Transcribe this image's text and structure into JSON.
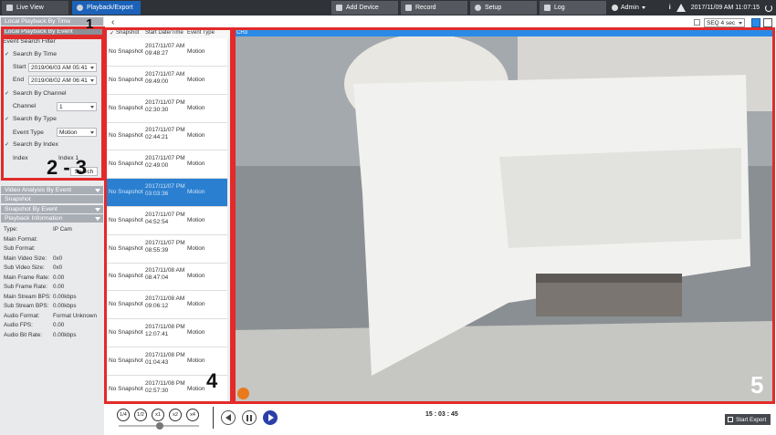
{
  "topbar": {
    "tabs": [
      {
        "label": "Live View",
        "icon": "live-view-icon"
      },
      {
        "label": "Playback/Export",
        "icon": "playback-icon",
        "active": true
      }
    ],
    "buttons": [
      {
        "label": "Add Device",
        "icon": "add-device-icon"
      },
      {
        "label": "Record",
        "icon": "record-icon"
      },
      {
        "label": "Setup",
        "icon": "gear-icon"
      },
      {
        "label": "Log",
        "icon": "log-icon"
      }
    ],
    "user": "Admin",
    "datetime": "2017/11/09 AM 11:07:15"
  },
  "sidebar": {
    "sections": {
      "local_by_time": "Local Playback By Time",
      "local_by_event": "Local Playback By Event",
      "filter_title": "Event Search Filter",
      "video_analysis": "Video Analysis By Event",
      "snapshot": "Snapshot",
      "snapshot_by_event": "Snapshot By Event",
      "playback_info": "Playback Information"
    },
    "filter": {
      "search_by_time": "Search By Time",
      "start_label": "Start",
      "start_value": "2019/06/03 AM 05:41",
      "end_label": "End",
      "end_value": "2019/08/02 AM 06:41",
      "search_by_channel": "Search By Channel",
      "channel_label": "Channel",
      "channel_value": "1",
      "search_by_type": "Search By Type",
      "event_type_label": "Event Type",
      "event_type_value": "Motion",
      "search_by_index": "Search By Index",
      "index_label": "Index",
      "index_value": "Index 1",
      "search_button": "Search"
    },
    "info": [
      {
        "k": "Type:",
        "v": "IP Cam"
      },
      {
        "k": "Main Format:",
        "v": ""
      },
      {
        "k": "Sub Format:",
        "v": ""
      },
      {
        "k": "Main Video Size:",
        "v": "0x0"
      },
      {
        "k": "Sub Video Size:",
        "v": "0x0"
      },
      {
        "k": "Main Frame Rate:",
        "v": "0.00"
      },
      {
        "k": "Sub Frame Rate:",
        "v": "0.00"
      },
      {
        "k": "Main Stream BPS:",
        "v": "0.00kbps"
      },
      {
        "k": "Sub Stream BPS:",
        "v": "0.00kbps"
      },
      {
        "k": "Audio Format:",
        "v": "Format Unknown"
      },
      {
        "k": "Audio FPS:",
        "v": "0.00"
      },
      {
        "k": "Audio Bit Rate:",
        "v": "0.00kbps"
      }
    ]
  },
  "list": {
    "headers": {
      "snapshot": "Snapshot",
      "datetime": "Start Date/Time",
      "type": "Event Type"
    },
    "rows": [
      {
        "snap": "No Snapshot",
        "d1": "2017/11/07  AM",
        "d2": "09:48:27",
        "type": "Motion"
      },
      {
        "snap": "No Snapshot",
        "d1": "2017/11/07  AM",
        "d2": "09:49:00",
        "type": "Motion"
      },
      {
        "snap": "No Snapshot",
        "d1": "2017/11/07  PM",
        "d2": "02:30:30",
        "type": "Motion"
      },
      {
        "snap": "No Snapshot",
        "d1": "2017/11/07  PM",
        "d2": "02:44:21",
        "type": "Motion"
      },
      {
        "snap": "No Snapshot",
        "d1": "2017/11/07  PM",
        "d2": "02:49:00",
        "type": "Motion"
      },
      {
        "snap": "No Snapshot",
        "d1": "2017/11/07  PM",
        "d2": "03:03:36",
        "type": "Motion",
        "selected": true
      },
      {
        "snap": "No Snapshot",
        "d1": "2017/11/07  PM",
        "d2": "04:52:54",
        "type": "Motion"
      },
      {
        "snap": "No Snapshot",
        "d1": "2017/11/07  PM",
        "d2": "08:55:39",
        "type": "Motion"
      },
      {
        "snap": "No Snapshot",
        "d1": "2017/11/08  AM",
        "d2": "08:47:04",
        "type": "Motion"
      },
      {
        "snap": "No Snapshot",
        "d1": "2017/11/08  AM",
        "d2": "09:06:12",
        "type": "Motion"
      },
      {
        "snap": "No Snapshot",
        "d1": "2017/11/08  PM",
        "d2": "12:07:41",
        "type": "Motion"
      },
      {
        "snap": "No Snapshot",
        "d1": "2017/11/08  PM",
        "d2": "01:04:43",
        "type": "Motion"
      },
      {
        "snap": "No Snapshot",
        "d1": "2017/11/08  PM",
        "d2": "02:57:30",
        "type": "Motion"
      }
    ]
  },
  "toolbar": {
    "seq": "SEQ 4 sec"
  },
  "video": {
    "channel": "CH3"
  },
  "playback": {
    "speeds": [
      "1/4",
      "1/2",
      "x1",
      "x2",
      "x4"
    ],
    "time": "15 : 03 : 45",
    "export_label": "Start Export"
  },
  "annotations": [
    "1",
    "2 - 3",
    "4",
    "5"
  ]
}
